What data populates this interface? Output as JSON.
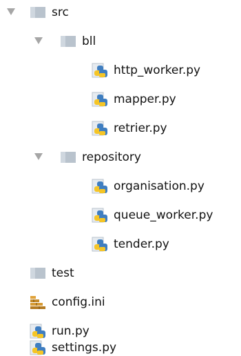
{
  "tree": {
    "src": {
      "name": "src",
      "icon": "folder-icon",
      "expanded": true
    },
    "bll": {
      "name": "bll",
      "icon": "folder-icon",
      "expanded": true
    },
    "http_worker": {
      "name": "http_worker.py",
      "icon": "python-file-icon"
    },
    "mapper": {
      "name": "mapper.py",
      "icon": "python-file-icon"
    },
    "retrier": {
      "name": "retrier.py",
      "icon": "python-file-icon"
    },
    "repository": {
      "name": "repository",
      "icon": "folder-icon",
      "expanded": true
    },
    "organisation": {
      "name": "organisation.py",
      "icon": "python-file-icon"
    },
    "queue_worker": {
      "name": "queue_worker.py",
      "icon": "python-file-icon"
    },
    "tender": {
      "name": "tender.py",
      "icon": "python-file-icon"
    },
    "test": {
      "name": "test",
      "icon": "folder-icon"
    },
    "config": {
      "name": "config.ini",
      "icon": "config-file-icon"
    },
    "run": {
      "name": "run.py",
      "icon": "python-file-icon"
    },
    "settings": {
      "name": "settings.py",
      "icon": "python-file-icon"
    }
  },
  "colors": {
    "folder": "#b9c3cd",
    "arrow": "#a6a6a6",
    "python_blue": "#3f7ec1",
    "python_yellow": "#f5c526",
    "config_brick": "#c58b2a"
  }
}
